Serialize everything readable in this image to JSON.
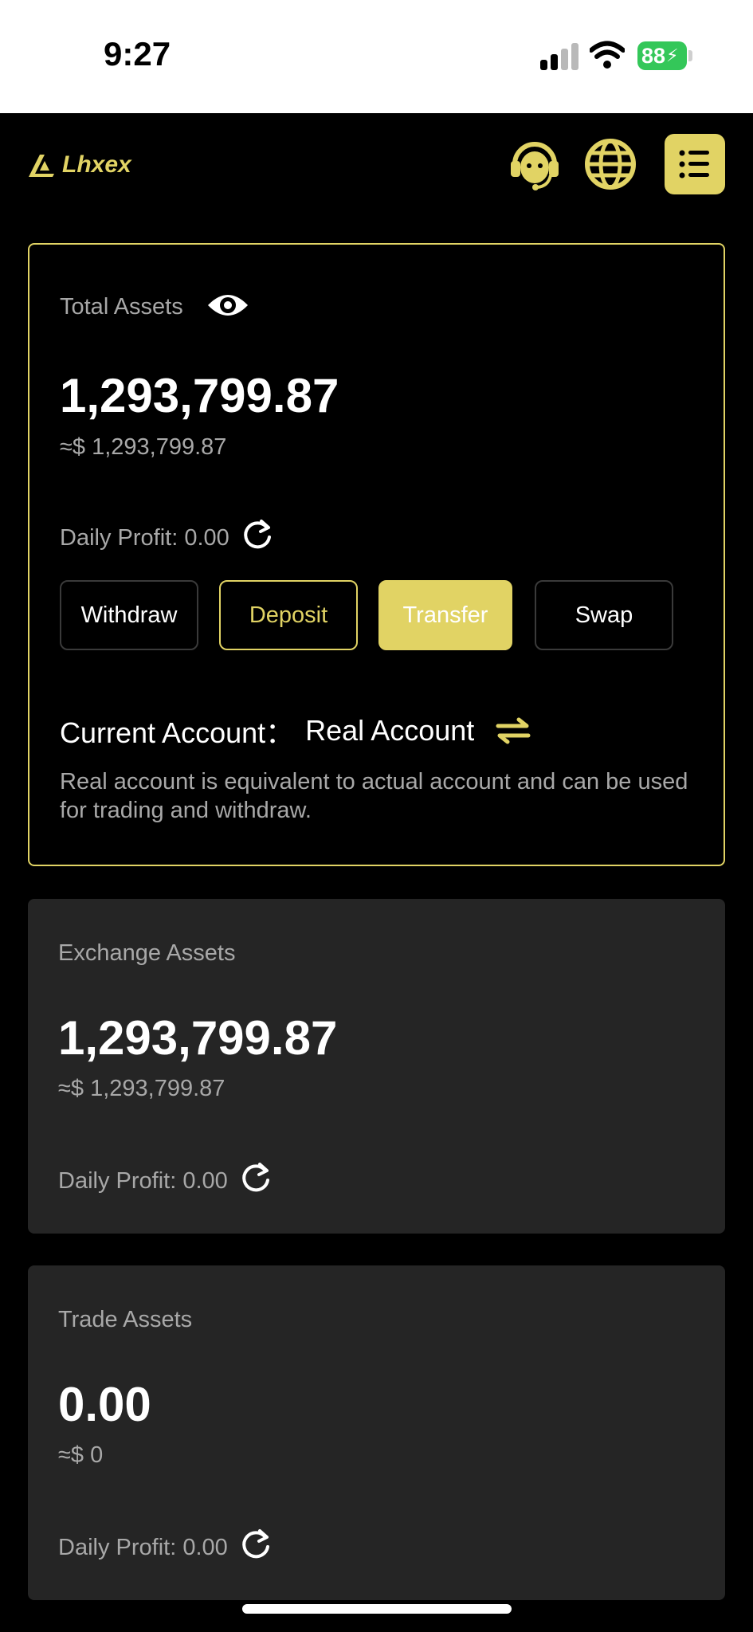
{
  "status_bar": {
    "time": "9:27",
    "battery": "88",
    "icons": [
      "cellular-signal-icon",
      "wifi-icon",
      "battery-charging-icon"
    ]
  },
  "header": {
    "brand": "Lhxex",
    "accent_color": "#e1d364",
    "icons": [
      "logo-icon",
      "customer-support-icon",
      "globe-icon",
      "menu-icon"
    ]
  },
  "total_assets": {
    "label": "Total Assets",
    "value": "1,293,799.87",
    "approx": "≈$ 1,293,799.87",
    "daily_profit": "Daily Profit: 0.00",
    "actions": {
      "withdraw": "Withdraw",
      "deposit": "Deposit",
      "transfer": "Transfer",
      "swap": "Swap"
    },
    "current_account_label": "Current Account：",
    "current_account_value": "Real Account",
    "description": "Real account is equivalent to actual account and can be used for trading and withdraw."
  },
  "exchange_assets": {
    "label": "Exchange Assets",
    "value": "1,293,799.87",
    "approx": "≈$ 1,293,799.87",
    "daily_profit": "Daily Profit: 0.00"
  },
  "trade_assets": {
    "label": "Trade Assets",
    "value": "0.00",
    "approx": "≈$ 0",
    "daily_profit": "Daily Profit: 0.00"
  }
}
